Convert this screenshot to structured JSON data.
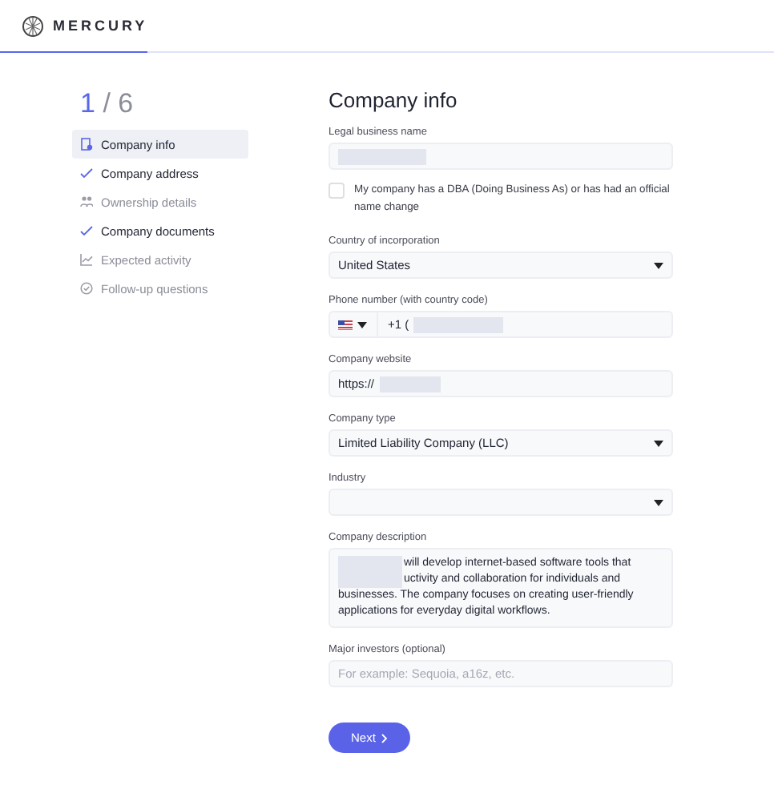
{
  "brand": "MERCURY",
  "progress": {
    "level": 0.19
  },
  "step": {
    "current": "1",
    "separator": "/",
    "total": "6"
  },
  "steps": [
    {
      "label": "Company info",
      "kind": "current",
      "selected": true,
      "completed": false
    },
    {
      "label": "Company address",
      "kind": "done",
      "selected": false,
      "completed": true
    },
    {
      "label": "Ownership details",
      "kind": "ownership",
      "selected": false,
      "completed": false
    },
    {
      "label": "Company documents",
      "kind": "done",
      "selected": false,
      "completed": true
    },
    {
      "label": "Expected activity",
      "kind": "activity",
      "selected": false,
      "completed": false
    },
    {
      "label": "Follow-up questions",
      "kind": "followup",
      "selected": false,
      "completed": false
    }
  ],
  "title": "Company info",
  "fields": [
    {
      "kind": "text",
      "label": "Legal business name",
      "redacted": true
    },
    {
      "kind": "checkbox",
      "label": "My company has a DBA (Doing Business As) or has had an official name change",
      "checked": false
    },
    {
      "kind": "select",
      "label": "Country of incorporation",
      "value": "United States"
    },
    {
      "kind": "phone",
      "label": "Phone number (with country code)",
      "value": "+1 (",
      "redacted": true
    },
    {
      "kind": "text",
      "label": "Company website",
      "value": "https://",
      "redacted": true
    },
    {
      "kind": "select",
      "label": "Company type",
      "value": "Limited Liability Company (LLC)"
    },
    {
      "kind": "select",
      "label": "Industry"
    },
    {
      "kind": "textarea",
      "label": "Company description",
      "lines": [
        {
          "redacted": true,
          "text": "will develop internet-based software tools that"
        },
        {
          "redacted": true,
          "text": "uctivity and collaboration for individuals and"
        },
        {
          "redacted": false,
          "text": "businesses. The company focuses on creating user-friendly"
        },
        {
          "redacted": false,
          "text": "applications for everyday digital workflows."
        }
      ]
    },
    {
      "kind": "text",
      "label": "Major investors (optional)",
      "placeholder": "For example: Sequoia, a16z, etc."
    }
  ],
  "next_button": "Next"
}
